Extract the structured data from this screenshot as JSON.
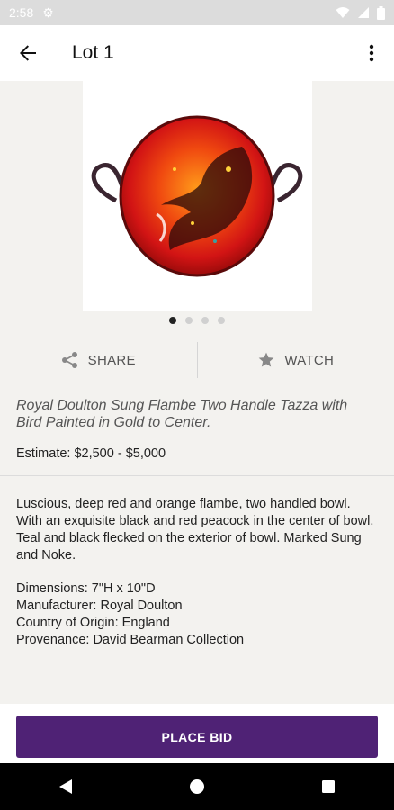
{
  "status_bar": {
    "time": "2:58"
  },
  "app_bar": {
    "title": "Lot 1"
  },
  "actions": {
    "share_label": "SHARE",
    "watch_label": "WATCH"
  },
  "carousel": {
    "current": 1,
    "total": 4
  },
  "lot": {
    "title": "Royal Doulton Sung Flambe Two Handle Tazza with Bird Painted in Gold to Center.",
    "estimate": "Estimate: $2,500 - $5,000",
    "description": "Luscious, deep red and orange flambe, two handled bowl. With an exquisite black and red peacock in the center of bowl. Teal and black flecked on the exterior of bowl. Marked Sung and Noke.",
    "specs": [
      "Dimensions: 7\"H x 10\"D",
      "Manufacturer: Royal Doulton",
      "Country of Origin: England",
      "Provenance: David Bearman Collection"
    ]
  },
  "bid_button": {
    "label": "PLACE BID"
  },
  "colors": {
    "accent": "#4f2275",
    "status_bar": "#dcdcdc"
  }
}
